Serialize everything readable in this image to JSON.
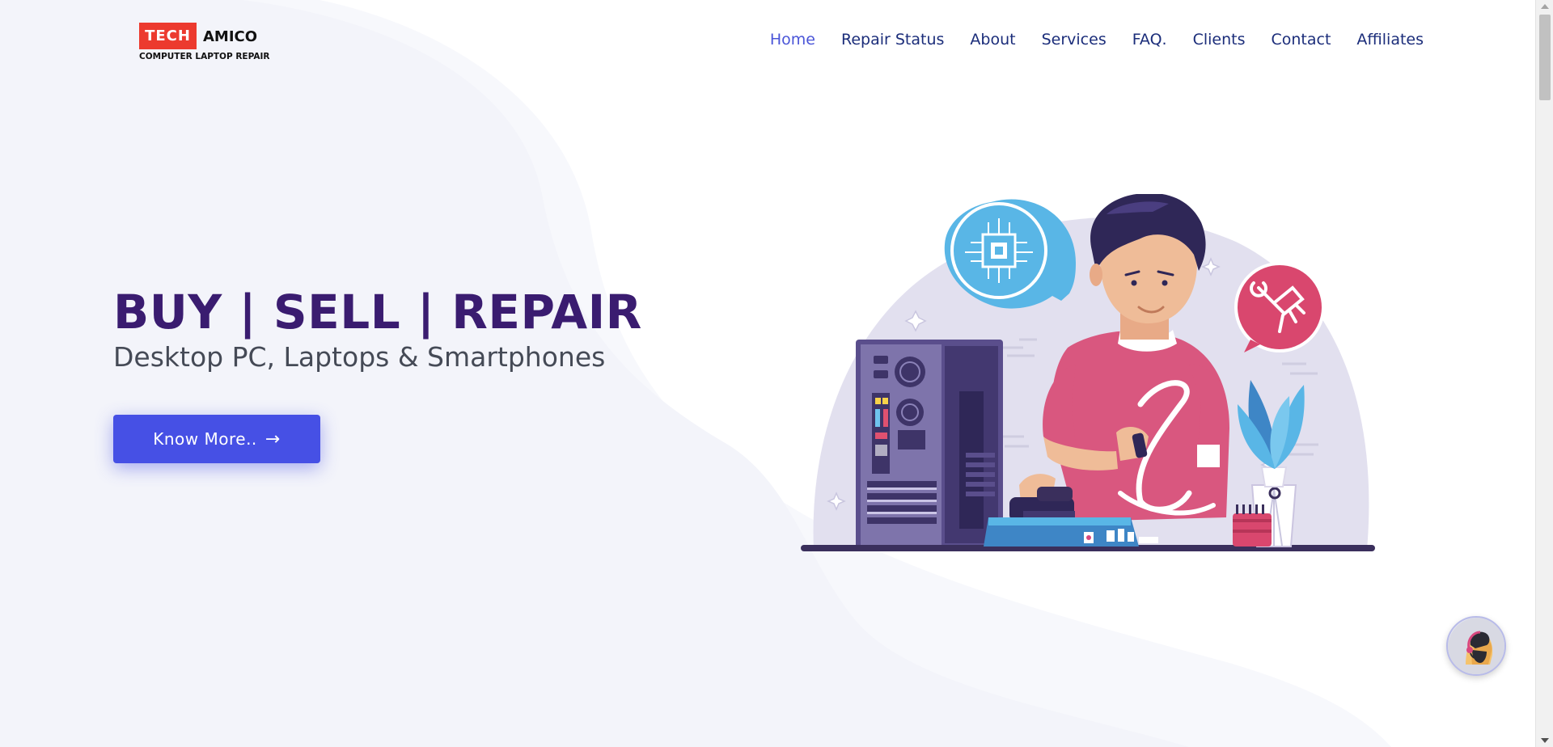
{
  "brand": {
    "logo_badge": "TECH",
    "logo_name": "AMICO",
    "logo_tagline": "COMPUTER LAPTOP REPAIR",
    "badge_color": "#ec3a2e"
  },
  "nav": {
    "items": [
      {
        "label": "Home",
        "active": true
      },
      {
        "label": "Repair Status",
        "active": false
      },
      {
        "label": "About",
        "active": false
      },
      {
        "label": "Services",
        "active": false
      },
      {
        "label": "FAQ.",
        "active": false
      },
      {
        "label": "Clients",
        "active": false
      },
      {
        "label": "Contact",
        "active": false
      },
      {
        "label": "Affiliates",
        "active": false
      }
    ],
    "color": "#1b2d7a",
    "active_color": "#4a55d8"
  },
  "hero": {
    "title": "BUY | SELL | REPAIR",
    "subtitle": "Desktop PC, Laptops & Smartphones",
    "cta_label": "Know More..",
    "cta_icon": "arrow-right-icon",
    "title_color": "#3a1c70",
    "cta_color": "#4650e5"
  },
  "illustration": {
    "icons": [
      "computer-tower-icon",
      "chip-speech-bubble-icon",
      "wrench-speech-bubble-icon",
      "plant-icon",
      "technician-figure"
    ]
  },
  "chat_widget": {
    "icon": "support-agent-icon"
  }
}
